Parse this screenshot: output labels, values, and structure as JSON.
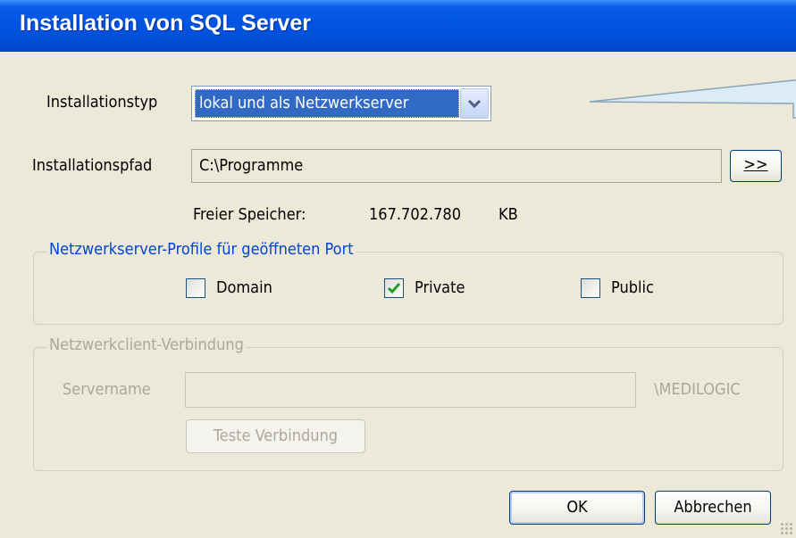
{
  "window": {
    "title": "Installation von SQL Server"
  },
  "install_type": {
    "label": "Installationstyp",
    "selected": "lokal und als Netzwerkserver"
  },
  "install_path": {
    "label": "Installationspfad",
    "value": "C:\\Programme",
    "browse_label": ">>"
  },
  "free_space": {
    "label": "Freier Speicher:",
    "value": "167.702.780",
    "unit": "KB"
  },
  "server_profiles": {
    "legend": "Netzwerkserver-Profile für geöffneten Port",
    "options": [
      {
        "label": "Domain",
        "checked": false
      },
      {
        "label": "Private",
        "checked": true
      },
      {
        "label": "Public",
        "checked": false
      }
    ]
  },
  "client_connection": {
    "legend": "Netzwerkclient-Verbindung",
    "server_label": "Servername",
    "server_value": "",
    "instance_suffix": "\\MEDILOGIC",
    "test_button": "Teste Verbindung"
  },
  "buttons": {
    "ok": "OK",
    "cancel": "Abbrechen"
  },
  "colors": {
    "title_bar": "#0055e3",
    "dialog_bg": "#ece9d8",
    "selection": "#316ac5",
    "group_legend": "#0046d5",
    "disabled_text": "#aca899"
  }
}
